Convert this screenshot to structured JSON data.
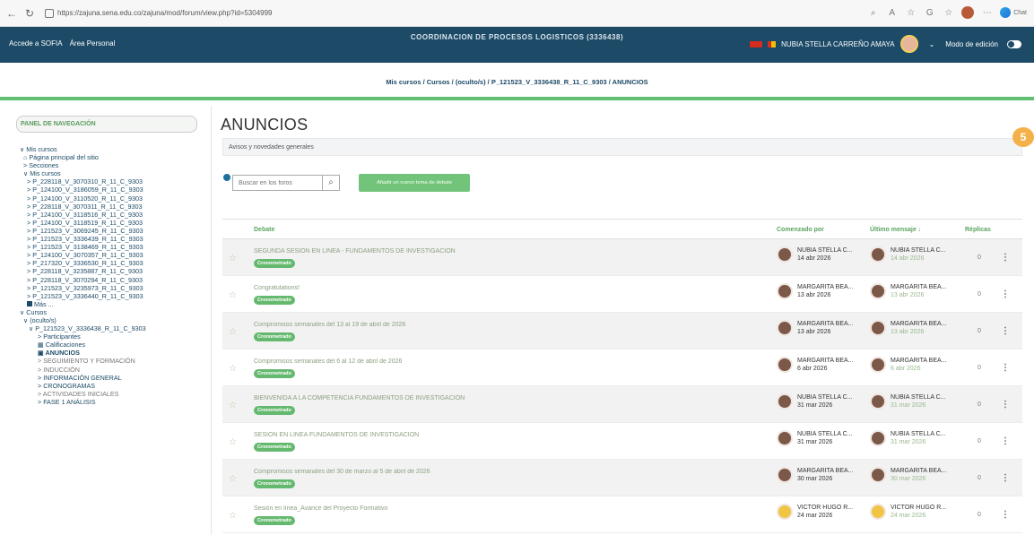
{
  "browser": {
    "back": "←",
    "reload": "↻",
    "url": "https://zajuna.sena.edu.co/zajuna/mod/forum/view.php?id=5304999",
    "chat_label": "Chat"
  },
  "appbar": {
    "left_items": [
      "Accede a SOFIA",
      "Área Personal"
    ],
    "user_name": "NUBIA STELLA CARREÑO AMAYA",
    "edit_mode_label": "Modo de edición",
    "course_title": "COORDINACION DE PROCESOS LOGISTICOS (3336438)"
  },
  "breadcrumb": {
    "text": "Mis cursos / Cursos / (oculto/s) / P_121523_V_3336438_R_11_C_9303 / ANUNCIOS"
  },
  "sidebar": {
    "panel_title": "PANEL DE NAVEGACIÓN",
    "items": [
      "∨ Mis cursos",
      "Página principal del sitio",
      "> Secciones",
      "∨ Mis cursos",
      "> P_228118_V_3070310_R_11_C_9303",
      "> P_124100_V_3186059_R_11_C_9303",
      "> P_124100_V_3110520_R_11_C_9303",
      "> P_228118_V_3070311_R_11_C_9303",
      "> P_124100_V_3118516_R_11_C_9303",
      "> P_124100_V_3118519_R_11_C_9303",
      "> P_121523_V_3069245_R_11_C_9303",
      "> P_121523_V_3336439_R_11_C_9303",
      "> P_121523_V_3138469_R_11_C_9303",
      "> P_124100_V_3070357_R_11_C_9303",
      "> P_217320_V_3336530_R_11_C_9303",
      "> P_228118_V_3235887_R_11_C_9303",
      "> P_228118_V_3070294_R_11_C_9303",
      "> P_121523_V_3235973_R_11_C_9303",
      "> P_121523_V_3336440_R_11_C_9303",
      "Más ...",
      "∨ Cursos",
      "∨ (oculto/s)",
      "∨ P_121523_V_3336438_R_11_C_9303",
      "> Participantes",
      "Calificaciones",
      "ANUNCIOS",
      "> SEGUIMIENTO Y FORMACIÓN",
      "> INDUCCIÓN",
      "> INFORMACIÓN GENERAL",
      "> CRONOGRAMAS",
      "> ACTIVIDADES INICIALES",
      "> FASE 1 ANÁLISIS"
    ]
  },
  "main": {
    "title": "ANUNCIOS",
    "subtitle": "Avisos y novedades generales",
    "badge_count": "5",
    "search_placeholder": "Buscar en los foros",
    "add_button": "Añadir un nuevo tema de debate",
    "table_headers": {
      "topic": "Debate",
      "started_by": "Comenzado por",
      "last_post": "Último mensaje ↓",
      "replies": "Réplicas"
    },
    "rows": [
      {
        "topic": "SEGUNDA SESIÓN EN LÍNEA - FUNDAMENTOS DE INVESTIGACIÓN",
        "badge": "Cronometrado",
        "author": "NUBIA STELLA C...",
        "date": "14 abr 2026",
        "last_author": "NUBIA STELLA C...",
        "last_date": "14 abr 2026",
        "replies": "0"
      },
      {
        "topic": "Congratulations!",
        "badge": "Cronometrado",
        "author": "MARGARITA BEA...",
        "date": "13 abr 2026",
        "last_author": "MARGARITA BEA...",
        "last_date": "13 abr 2026",
        "replies": "0"
      },
      {
        "topic": "Compromisos semanales del 13 al 19 de abril de 2026",
        "badge": "Cronometrado",
        "author": "MARGARITA BEA...",
        "date": "13 abr 2026",
        "last_author": "MARGARITA BEA...",
        "last_date": "13 abr 2026",
        "replies": "0"
      },
      {
        "topic": "Compromisos semanales del 6 al 12 de abril de 2026",
        "badge": "Cronometrado",
        "author": "MARGARITA BEA...",
        "date": "6 abr 2026",
        "last_author": "MARGARITA BEA...",
        "last_date": "6 abr 2026",
        "replies": "0"
      },
      {
        "topic": "BIENVENIDA A LA COMPETENCIA FUNDAMENTOS DE INVESTIGACIÓN",
        "badge": "Cronometrado",
        "author": "NUBIA STELLA C...",
        "date": "31 mar 2026",
        "last_author": "NUBIA STELLA C...",
        "last_date": "31 mar 2026",
        "replies": "0"
      },
      {
        "topic": "SESIÓN EN LÍNEA FUNDAMENTOS DE INVESTIGACIÓN",
        "badge": "Cronometrado",
        "author": "NUBIA STELLA C...",
        "date": "31 mar 2026",
        "last_author": "NUBIA STELLA C...",
        "last_date": "31 mar 2026",
        "replies": "0"
      },
      {
        "topic": "Compromisos semanales del 30 de marzo al 5 de abril de 2026",
        "badge": "Cronometrado",
        "author": "MARGARITA BEA...",
        "date": "30 mar 2026",
        "last_author": "MARGARITA BEA...",
        "last_date": "30 mar 2026",
        "replies": "0"
      },
      {
        "topic": "Sesión en línea_Avance del Proyecto Formativo",
        "badge": "Cronometrado",
        "author": "VICTOR HUGO R...",
        "date": "24 mar 2026",
        "last_author": "VICTOR HUGO R...",
        "last_date": "24 mar 2026",
        "replies": "0"
      }
    ]
  }
}
